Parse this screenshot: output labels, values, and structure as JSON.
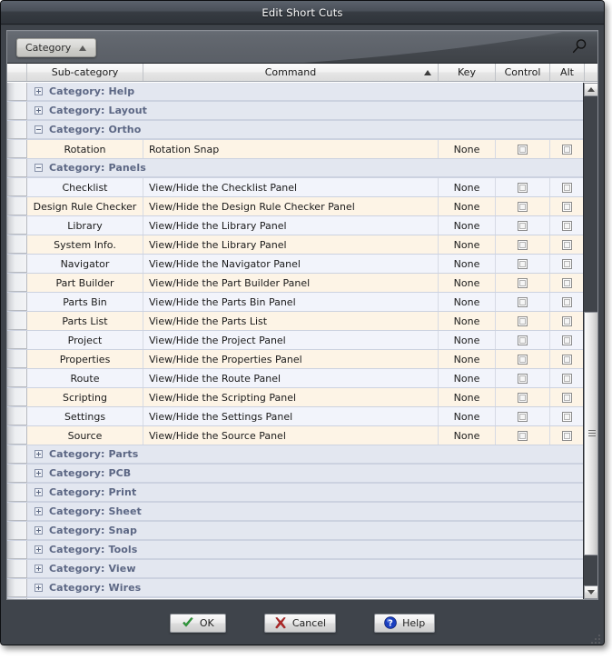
{
  "window": {
    "title": "Edit Short Cuts"
  },
  "toolbar": {
    "group_chip_label": "Category",
    "group_chip_sort": "ascending",
    "search_icon": "search-icon"
  },
  "grid": {
    "columns": [
      {
        "key": "gutter",
        "label": ""
      },
      {
        "key": "subcategory",
        "label": "Sub-category"
      },
      {
        "key": "command",
        "label": "Command",
        "sort": "ascending"
      },
      {
        "key": "key",
        "label": "Key"
      },
      {
        "key": "control",
        "label": "Control"
      },
      {
        "key": "alt",
        "label": "Alt"
      }
    ],
    "rows": [
      {
        "type": "group",
        "label": "Category: Help",
        "expanded": false
      },
      {
        "type": "group",
        "label": "Category: Layout",
        "expanded": false
      },
      {
        "type": "group",
        "label": "Category: Ortho",
        "expanded": true
      },
      {
        "type": "data",
        "subcategory": "Rotation",
        "command": "Rotation Snap",
        "key": "None",
        "control": false,
        "alt": false
      },
      {
        "type": "group",
        "label": "Category: Panels",
        "expanded": true
      },
      {
        "type": "data",
        "subcategory": "Checklist",
        "command": "View/Hide the Checklist Panel",
        "key": "None",
        "control": false,
        "alt": false
      },
      {
        "type": "data",
        "subcategory": "Design Rule Checker",
        "command": "View/Hide the Design Rule Checker Panel",
        "key": "None",
        "control": false,
        "alt": false
      },
      {
        "type": "data",
        "subcategory": "Library",
        "command": "View/Hide the Library Panel",
        "key": "None",
        "control": false,
        "alt": false
      },
      {
        "type": "data",
        "subcategory": "System Info.",
        "command": "View/Hide the Library Panel",
        "key": "None",
        "control": false,
        "alt": false
      },
      {
        "type": "data",
        "subcategory": "Navigator",
        "command": "View/Hide the Navigator Panel",
        "key": "None",
        "control": false,
        "alt": false
      },
      {
        "type": "data",
        "subcategory": "Part Builder",
        "command": "View/Hide the Part Builder Panel",
        "key": "None",
        "control": false,
        "alt": false
      },
      {
        "type": "data",
        "subcategory": "Parts Bin",
        "command": "View/Hide the Parts Bin Panel",
        "key": "None",
        "control": false,
        "alt": false
      },
      {
        "type": "data",
        "subcategory": "Parts List",
        "command": "View/Hide the Parts List",
        "key": "None",
        "control": false,
        "alt": false
      },
      {
        "type": "data",
        "subcategory": "Project",
        "command": "View/Hide the Project Panel",
        "key": "None",
        "control": false,
        "alt": false
      },
      {
        "type": "data",
        "subcategory": "Properties",
        "command": "View/Hide the Properties Panel",
        "key": "None",
        "control": false,
        "alt": false
      },
      {
        "type": "data",
        "subcategory": "Route",
        "command": "View/Hide the Route Panel",
        "key": "None",
        "control": false,
        "alt": false
      },
      {
        "type": "data",
        "subcategory": "Scripting",
        "command": "View/Hide the Scripting Panel",
        "key": "None",
        "control": false,
        "alt": false
      },
      {
        "type": "data",
        "subcategory": "Settings",
        "command": "View/Hide the Settings Panel",
        "key": "None",
        "control": false,
        "alt": false
      },
      {
        "type": "data",
        "subcategory": "Source",
        "command": "View/Hide the Source Panel",
        "key": "None",
        "control": false,
        "alt": false
      },
      {
        "type": "group",
        "label": "Category: Parts",
        "expanded": false
      },
      {
        "type": "group",
        "label": "Category: PCB",
        "expanded": false
      },
      {
        "type": "group",
        "label": "Category: Print",
        "expanded": false
      },
      {
        "type": "group",
        "label": "Category: Sheet",
        "expanded": false
      },
      {
        "type": "group",
        "label": "Category: Snap",
        "expanded": false
      },
      {
        "type": "group",
        "label": "Category: Tools",
        "expanded": false
      },
      {
        "type": "group",
        "label": "Category: View",
        "expanded": false
      },
      {
        "type": "group",
        "label": "Category: Wires",
        "expanded": false
      }
    ]
  },
  "scrollbar": {
    "up_arrow": "scroll-up-icon",
    "down_arrow": "scroll-down-icon"
  },
  "buttons": [
    {
      "id": "ok",
      "label": "OK",
      "icon": "check-icon"
    },
    {
      "id": "cancel",
      "label": "Cancel",
      "icon": "cross-icon"
    },
    {
      "id": "help",
      "label": "Help",
      "icon": "question-icon"
    }
  ],
  "colors": {
    "title_bar": "#4a5059",
    "row_odd": "#fdf4e6",
    "row_even": "#f2f4fb",
    "group_row": "#e3e7f0",
    "group_label": "#5c6784",
    "ok_icon": "#2e9b3a",
    "cancel_icon": "#b02727",
    "help_icon": "#1a3fc0"
  }
}
